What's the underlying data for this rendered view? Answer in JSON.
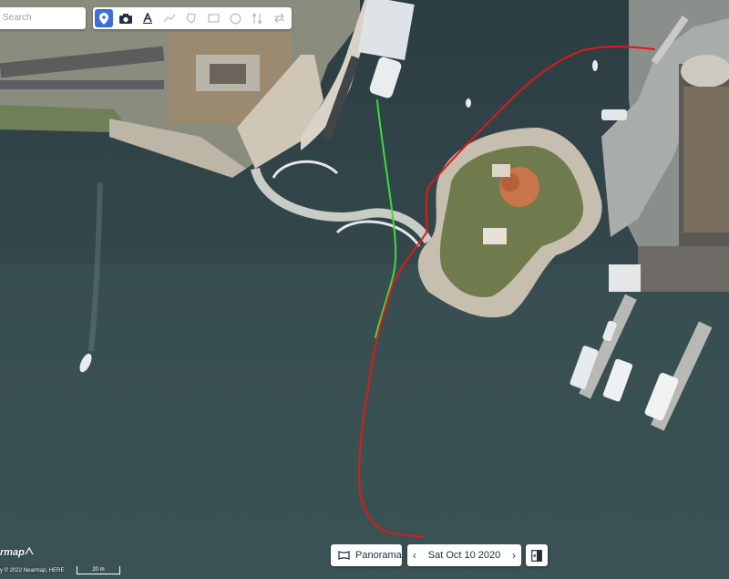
{
  "search": {
    "placeholder": "Search"
  },
  "toolbar": {
    "tools": [
      "location-pin",
      "camera",
      "text",
      "polyline",
      "polygon",
      "rectangle",
      "circle",
      "height",
      "swap"
    ],
    "active_tool": "location-pin",
    "active_color": "#3b6fd8"
  },
  "bottom_bar": {
    "panorama_label": "Panorama",
    "date_label": "Sat Oct 10 2020"
  },
  "footer": {
    "brand": "rmap",
    "copyright": "y © 2022 Nearmap, HERE",
    "scale_label": "20 m"
  },
  "drawn_paths": {
    "green_path_color": "#3cdc3c",
    "red_path_color": "#e01818"
  }
}
